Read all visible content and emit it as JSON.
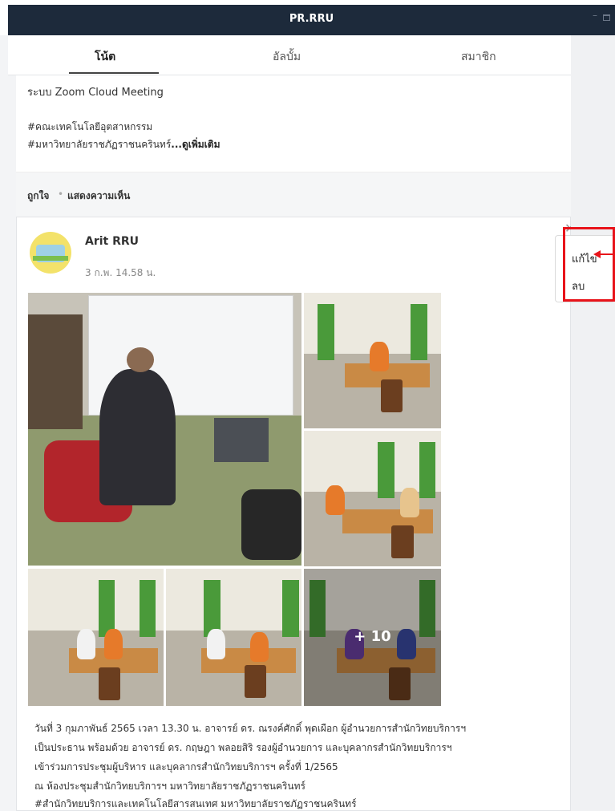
{
  "window": {
    "title": "PR.RRU"
  },
  "tabs": [
    {
      "label": "โน้ต",
      "active": true
    },
    {
      "label": "อัลบั้ม",
      "active": false
    },
    {
      "label": "สมาชิก",
      "active": false
    }
  ],
  "post1": {
    "text_line": "ระบบ Zoom Cloud Meeting",
    "hashtag1": "#คณะเทคโนโลยีอุตสาหกรรม",
    "hashtag2": "#มหาวิทยาลัยราชภัฏราชนครินทร์",
    "see_more": "...ดูเพิ่มเติม",
    "like": "ถูกใจ",
    "separator": "•",
    "comment": "แสดงความเห็น"
  },
  "post2": {
    "author": "Arit RRU",
    "time": "3 ก.พ. 14.58 น.",
    "more_photos": "+ 10",
    "caption": [
      "วันที่ 3 กุมภาพันธ์ 2565 เวลา 13.30 น. อาจารย์ ดร. ณรงค์ศักดิ์ พุดเผือก ผู้อำนวยการสำนักวิทยบริการฯ",
      "เป็นประธาน พร้อมด้วย อาจารย์ ดร. กฤษฎา พลอยสิริ รองผู้อำนวยการ และบุคลากรสำนักวิทยบริการฯ",
      "เข้าร่วมการประชุมผู้บริหาร และบุคลากรสำนักวิทยบริการฯ ครั้งที่ 1/2565",
      "ณ ห้องประชุมสำนักวิทยบริการฯ มหาวิทยาลัยราชภัฏราชนครินทร์",
      "#สำนักวิทยบริการและเทคโนโลยีสารสนเทศ มหาวิทยาลัยราชภัฏราชนครินทร์"
    ]
  },
  "context_menu": {
    "edit": "แก้ไข",
    "delete": "ลบ"
  },
  "colors": {
    "titlebar": "#1d2a3b",
    "highlight": "#e8131a"
  },
  "icons": {
    "close": "close-icon",
    "minimize": "minimize-icon",
    "maximize": "maximize-icon"
  }
}
